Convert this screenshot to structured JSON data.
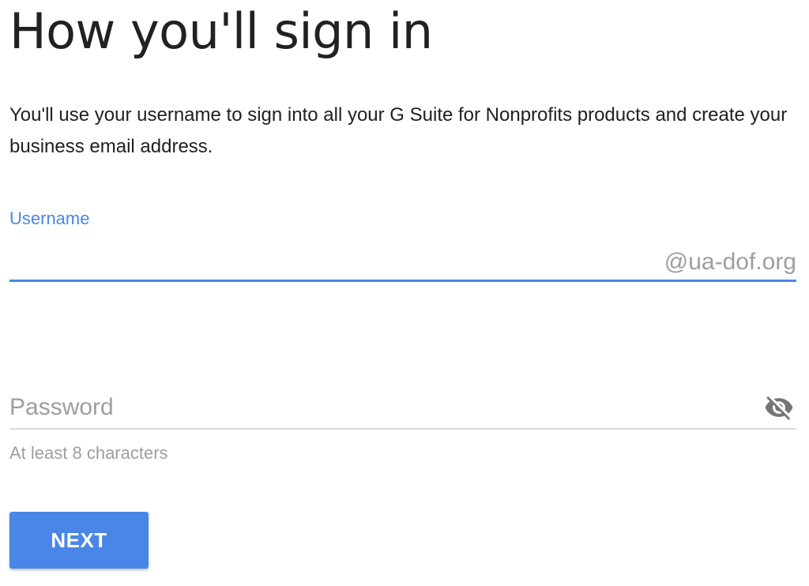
{
  "heading": "How you'll sign in",
  "description": "You'll use your username to sign into all your G Suite for Nonprofits products and create your business email address.",
  "username": {
    "label": "Username",
    "value": "",
    "domain_suffix": "@ua-dof.org"
  },
  "password": {
    "placeholder": "Password",
    "value": "",
    "hint": "At least 8 characters",
    "toggle_icon": "visibility-off-icon"
  },
  "next_button": {
    "label": "NEXT"
  },
  "colors": {
    "accent": "#4a86e8",
    "text": "#212121",
    "muted": "#9e9e9e",
    "divider": "#dcdcdc"
  }
}
